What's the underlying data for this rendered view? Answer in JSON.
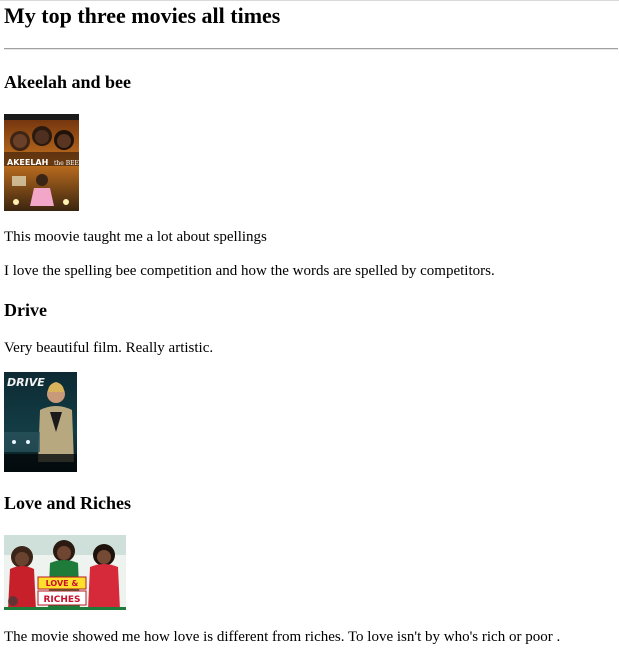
{
  "page": {
    "title": "My top three movies all times"
  },
  "movies": [
    {
      "title": "Akeelah and bee",
      "poster_alt": "Akeelah and the Bee poster",
      "poster_text": "AKEELAH and the BEE",
      "paragraphs": [
        "This moovie taught me a lot about spellings",
        "I love the spelling bee competition and how the words are spelled by competitors."
      ]
    },
    {
      "title": "Drive",
      "poster_alt": "Drive poster",
      "poster_text": "DRIVE",
      "paragraphs": [
        "Very beautiful film. Really artistic."
      ]
    },
    {
      "title": "Love and Riches",
      "poster_alt": "Love and Riches poster",
      "poster_text": "LOVE & RICHES",
      "paragraphs": [
        "The movie showed me how love is different from riches. To love isn't by who's rich or poor ."
      ]
    }
  ]
}
